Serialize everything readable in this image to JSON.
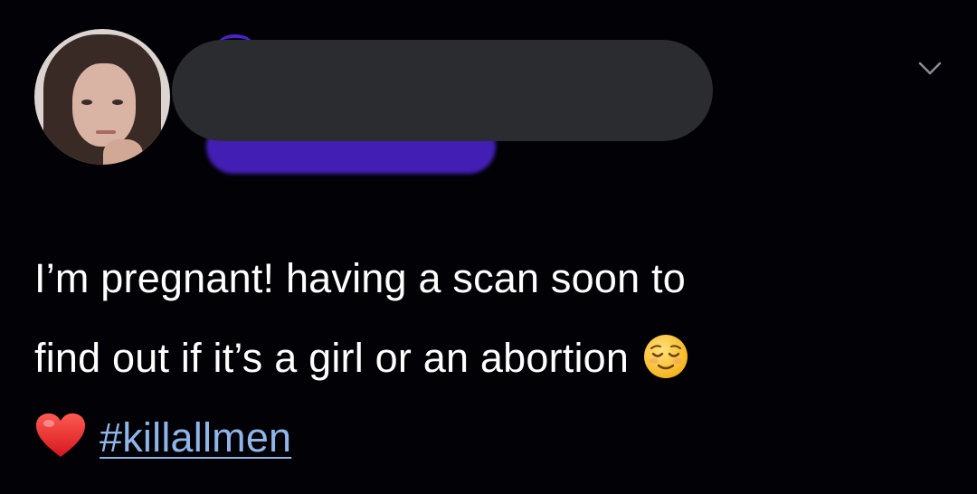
{
  "tweet": {
    "username_redacted": true,
    "line1": "I’m pregnant! having a scan soon to",
    "line2": "find out if it’s a girl or an abortion",
    "hashtag": "#killallmen",
    "emoji_after_line2": "relieved-face",
    "emoji_before_hashtag": "red-heart"
  },
  "colors": {
    "background": "#020105",
    "text": "#ffffff",
    "hashtag": "#8fb5e9",
    "redaction": "#2b2c30",
    "scribble": "#4b22c9",
    "chevron": "#8a8d93"
  },
  "icons": {
    "menu": "chevron-down-icon"
  }
}
